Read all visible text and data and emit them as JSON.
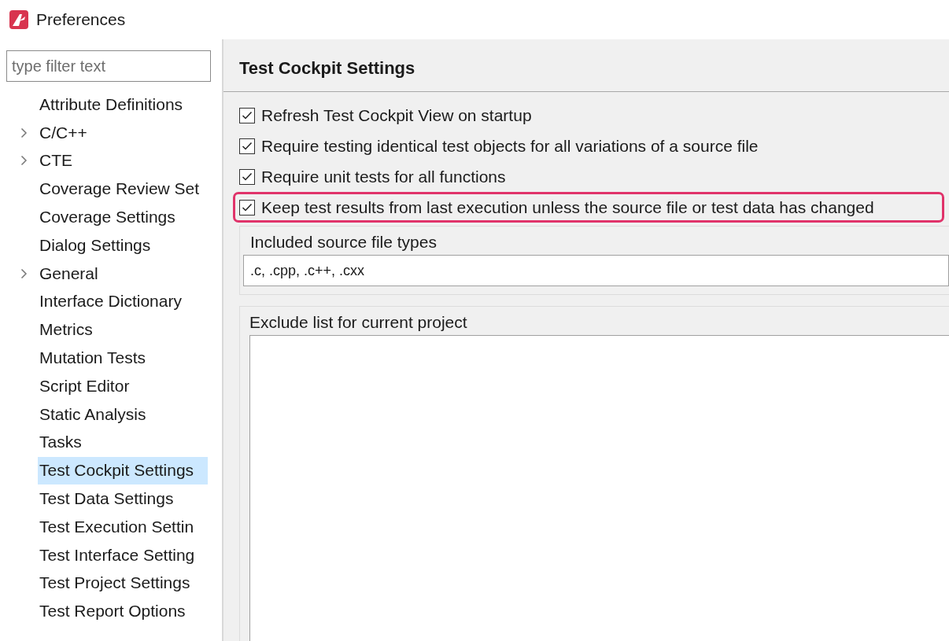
{
  "window": {
    "title": "Preferences"
  },
  "sidebar": {
    "filter": {
      "placeholder": "type filter text"
    },
    "items": [
      {
        "label": "Attribute Definitions",
        "expandable": false,
        "selected": false
      },
      {
        "label": "C/C++",
        "expandable": true,
        "selected": false
      },
      {
        "label": "CTE",
        "expandable": true,
        "selected": false
      },
      {
        "label": "Coverage Review Set",
        "expandable": false,
        "selected": false
      },
      {
        "label": "Coverage Settings",
        "expandable": false,
        "selected": false
      },
      {
        "label": "Dialog Settings",
        "expandable": false,
        "selected": false
      },
      {
        "label": "General",
        "expandable": true,
        "selected": false
      },
      {
        "label": "Interface Dictionary",
        "expandable": false,
        "selected": false
      },
      {
        "label": "Metrics",
        "expandable": false,
        "selected": false
      },
      {
        "label": "Mutation Tests",
        "expandable": false,
        "selected": false
      },
      {
        "label": "Script Editor",
        "expandable": false,
        "selected": false
      },
      {
        "label": "Static Analysis",
        "expandable": false,
        "selected": false
      },
      {
        "label": "Tasks",
        "expandable": false,
        "selected": false
      },
      {
        "label": "Test Cockpit Settings",
        "expandable": false,
        "selected": true
      },
      {
        "label": "Test Data Settings",
        "expandable": false,
        "selected": false
      },
      {
        "label": "Test Execution Settin",
        "expandable": false,
        "selected": false
      },
      {
        "label": "Test Interface Setting",
        "expandable": false,
        "selected": false
      },
      {
        "label": "Test Project Settings",
        "expandable": false,
        "selected": false
      },
      {
        "label": "Test Report Options",
        "expandable": false,
        "selected": false
      }
    ]
  },
  "page": {
    "title": "Test Cockpit Settings",
    "options": [
      {
        "label": "Refresh Test Cockpit View on startup",
        "checked": true,
        "highlighted": false
      },
      {
        "label": "Require testing identical test objects for all variations of a source file",
        "checked": true,
        "highlighted": false
      },
      {
        "label": "Require unit tests for all functions",
        "checked": true,
        "highlighted": false
      },
      {
        "label": "Keep test results from last execution unless the source file or test data has changed",
        "checked": true,
        "highlighted": true
      }
    ],
    "included_types": {
      "label": "Included source file types",
      "value": ".c, .cpp, .c++, .cxx"
    },
    "exclude_list": {
      "label": "Exclude list for current project"
    }
  }
}
